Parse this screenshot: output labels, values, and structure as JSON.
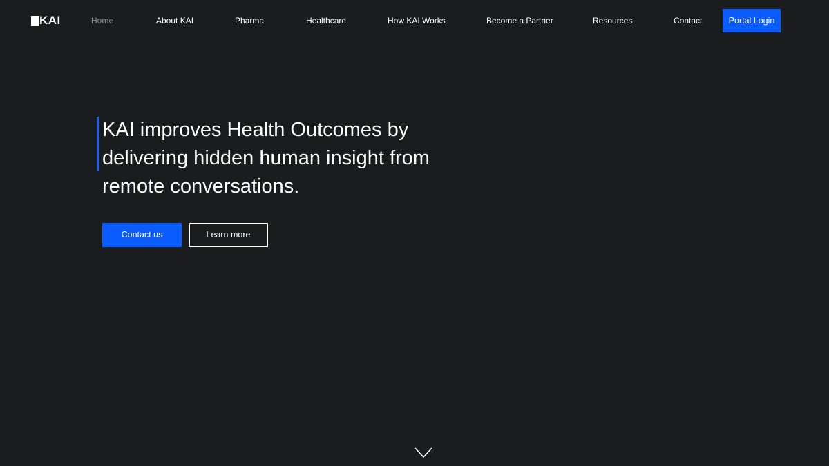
{
  "brand": {
    "logo_text": "KAI"
  },
  "nav": {
    "items": [
      {
        "label": "Home"
      },
      {
        "label": "About KAI"
      },
      {
        "label": "Pharma"
      },
      {
        "label": "Healthcare"
      },
      {
        "label": "How KAI Works"
      },
      {
        "label": "Become a Partner"
      },
      {
        "label": "Resources"
      },
      {
        "label": "Contact"
      }
    ],
    "active": "Home",
    "portal_label": "Portal Login"
  },
  "hero": {
    "headline": "KAI improves Health Outcomes by delivering hidden human insight from remote conversations.",
    "primary_cta": "Contact us",
    "secondary_cta": "Learn more"
  },
  "icons": {
    "scroll": "chevron-down-icon"
  },
  "colors": {
    "background": "#1b1c1e",
    "accent": "#0a5cff",
    "nav_active": "#8b8c8e",
    "text": "#ffffff"
  }
}
